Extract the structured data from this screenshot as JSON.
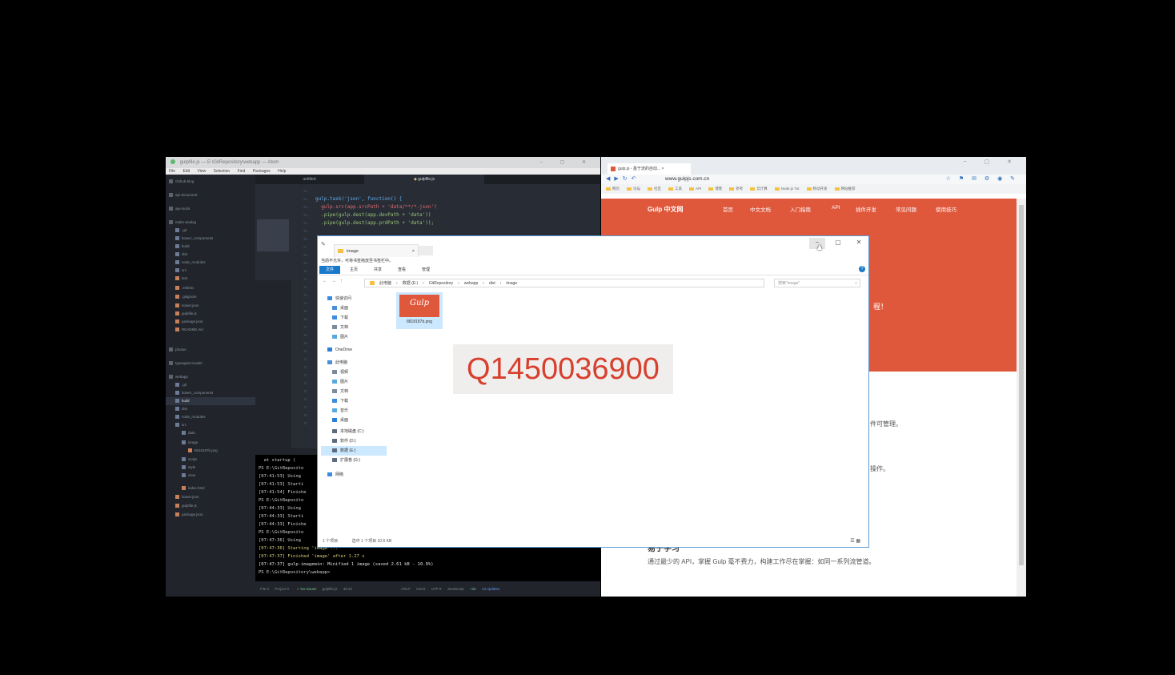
{
  "atom": {
    "title": "gulpfile.js — E:\\GitRepository\\webapp — Atom",
    "menu": [
      "File",
      "Edit",
      "View",
      "Selection",
      "Find",
      "Packages",
      "Help"
    ],
    "tabs": [
      "untitled",
      "gulpfile.js"
    ],
    "tree": [
      "Github-blog",
      "api-document",
      "api-mock",
      "make-analog",
      ".git",
      "bower_components",
      "build",
      "dist",
      "node_modules",
      "src",
      "test",
      ".eslintrc",
      ".gitignore",
      "bower.json",
      "gulpfile.js",
      "package.json",
      "README.md",
      "photon",
      "typeagent-model",
      "webapp",
      ".git",
      "bower_components",
      "build",
      "dist",
      "node_modules",
      "src",
      "data",
      "image",
      "8818187b.png",
      "script",
      "style",
      "view",
      "index.html",
      "bower.json",
      "gulpfile.js",
      "package.json"
    ],
    "code": [
      "gulp.task('json', function() {",
      "  gulp.src(app.srcPath + 'data/**/*.json')",
      "  .pipe(gulp.dest(app.devPath + 'data'))",
      "  .pipe(gulp.dest(app.prdPath + 'data'));"
    ],
    "terminal": [
      "  at startup (",
      "PS E:\\GitReposito",
      "[07:41:53] Using",
      "[07:41:53] Starti",
      "[07:41:54] Finishe",
      "PS E:\\GitReposito",
      "[07:44:33] Using",
      "[07:44:33] Starti",
      "[07:44:33] Finishe",
      "PS E:\\GitReposito",
      "[07:47:36] Using",
      "[07:47:36] Starting 'image'...",
      "[07:47:37] Finished 'image' after 1.27 s",
      "[07:47:37] gulp-imagemin: Minified 1 image (saved 2.61 kB - 10.9%)",
      "PS E:\\GitRepository\\webapp>"
    ],
    "status": [
      "File 0",
      "Project 0",
      "No Issues",
      "gulpfile.js",
      "46:43",
      "CRLF",
      "Insert",
      "UTF-8",
      "JavaScript",
      "+32",
      "13 updates"
    ]
  },
  "browser": {
    "tab_title": "gulp.js - 基于流的自动...",
    "url": "www.gulpjs.com.cn",
    "bookmarks": [
      "网页",
      "论坛",
      "社区",
      "工具",
      "API",
      "博客",
      "参考",
      "云计算",
      "Node.js Tut",
      "移动开发",
      "网站推荐"
    ],
    "brand": "Gulp 中文网",
    "nav": [
      "首页",
      "中文文档",
      "入门指南",
      "API",
      "插件开发",
      "常见问题",
      "使用技巧"
    ],
    "hero_fragment": "程！",
    "body_fragment_1": "件可管理。",
    "body_fragment_2": "操作。",
    "section_title": "易于学习",
    "section_text": "通过最少的 API，掌握 Gulp 毫不费力，构建工作尽在掌握：如同一系列流管道。"
  },
  "explorer": {
    "tab_title": "image",
    "ribbon_tip": "当前不允许，可将书签拖放至书签栏中。",
    "ribbon_tabs": [
      "文件",
      "主页",
      "共享",
      "查看",
      "管理"
    ],
    "path": [
      "此电脑",
      "数据 (E:)",
      "GitRepository",
      "webapp",
      "dist",
      "image"
    ],
    "search_placeholder": "搜索\"image\"",
    "nav": [
      "快速访问",
      "桌面",
      "下载",
      "文档",
      "图片",
      "OneDrive",
      "此电脑",
      "视频",
      "图片",
      "文档",
      "下载",
      "音乐",
      "桌面",
      "本地磁盘 (C:)",
      "软件 (D:)",
      "数据 (E:)",
      "扩展卷 (G:)",
      "网络"
    ],
    "file_thumb_text": "Gulp",
    "file_name": "8818187b.png",
    "status": [
      "1 个项目",
      "选中 1 个项目 10.6 KB"
    ]
  },
  "watermark": "Q1450036900",
  "colors": {
    "gulp_red": "#e0583c",
    "atom_bg": "#282c34",
    "explorer_accent": "#1979ca",
    "watermark_text": "#d8402e"
  }
}
